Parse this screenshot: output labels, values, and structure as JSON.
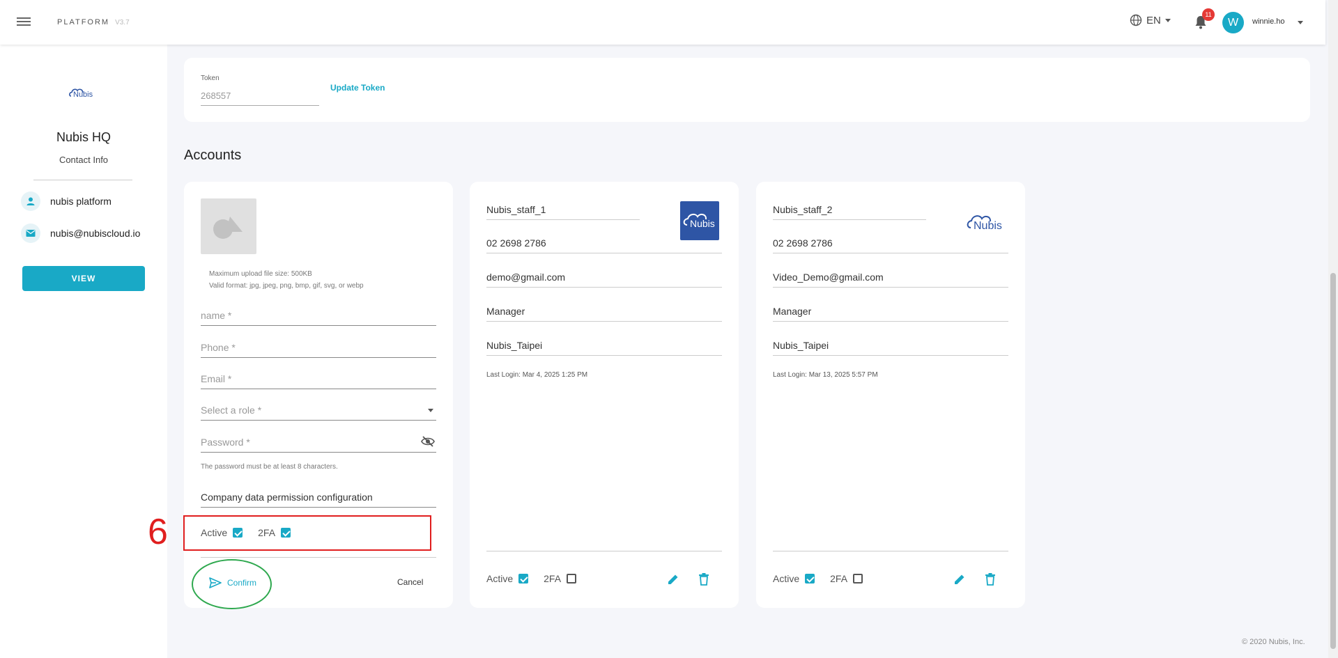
{
  "header": {
    "brand": "PLATFORM",
    "version": "V3.7",
    "language": "EN",
    "notification_count": "11",
    "avatar_letter": "W",
    "username": "winnie.ho"
  },
  "sidebar": {
    "company_name": "Nubis HQ",
    "contact_info_label": "Contact Info",
    "contact_name": "nubis platform",
    "contact_email": "nubis@nubiscloud.io",
    "view_button": "VIEW"
  },
  "token": {
    "label": "Token",
    "value": "268557",
    "update_button": "Update Token"
  },
  "accounts": {
    "title": "Accounts",
    "new_form": {
      "upload_hint_size": "Maximum upload file size: 500KB",
      "upload_hint_format": "Valid format: jpg, jpeg, png, bmp, gif, svg, or webp",
      "name_placeholder": "name *",
      "phone_placeholder": "Phone *",
      "email_placeholder": "Email *",
      "role_placeholder": "Select a role *",
      "password_placeholder": "Password *",
      "password_hint": "The password must be at least 8 characters.",
      "permission_config": "Company data permission configuration",
      "active_label": "Active",
      "twofa_label": "2FA",
      "active_checked": true,
      "twofa_checked": true,
      "confirm_button": "Confirm",
      "cancel_button": "Cancel"
    },
    "list": [
      {
        "name": "Nubis_staff_1",
        "phone": "02 2698 2786",
        "email": "demo@gmail.com",
        "role": "Manager",
        "company": "Nubis_Taipei",
        "last_login": "Last Login: Mar 4, 2025 1:25 PM",
        "active_label": "Active",
        "twofa_label": "2FA",
        "active_checked": true,
        "twofa_checked": false,
        "logo_text": "Nubis"
      },
      {
        "name": "Nubis_staff_2",
        "phone": "02 2698 2786",
        "email": "Video_Demo@gmail.com",
        "role": "Manager",
        "company": "Nubis_Taipei",
        "last_login": "Last Login: Mar 13, 2025 5:57 PM",
        "active_label": "Active",
        "twofa_label": "2FA",
        "active_checked": true,
        "twofa_checked": false,
        "logo_text": "Nubis"
      }
    ]
  },
  "annotation": {
    "step_number": "6"
  },
  "footer": {
    "copyright": "© 2020 Nubis, Inc."
  },
  "colors": {
    "accent": "#19a9c6",
    "annotation_red": "#e01e1e",
    "annotation_green": "#2ea84e",
    "logo_blue": "#2e55a5"
  }
}
